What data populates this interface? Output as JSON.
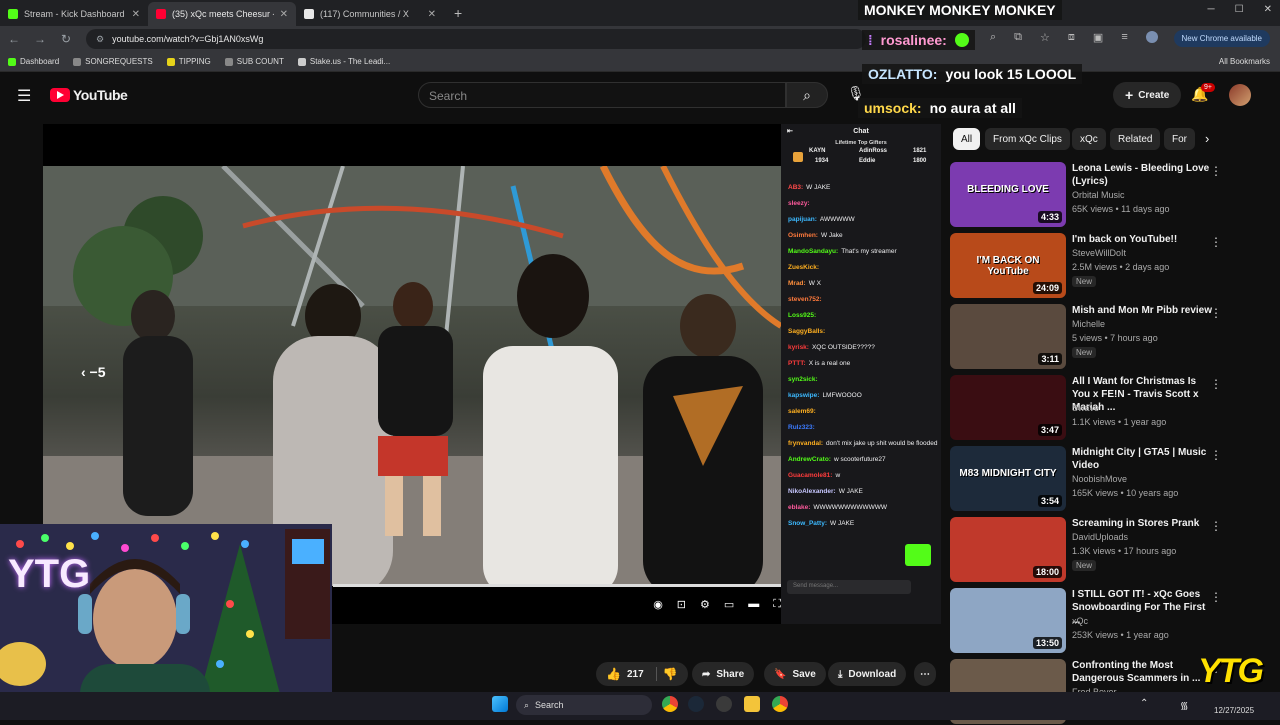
{
  "browser": {
    "tabs": [
      {
        "title": "Stream - Kick Dashboard",
        "favicon_color": "#53fc18"
      },
      {
        "title": "(35) xQc meets Cheesur - YouTube",
        "favicon_color": "#ff0033"
      },
      {
        "title": "(117) Communities / X",
        "favicon_color": "#e8e8e8"
      }
    ],
    "url": "youtube.com/watch?v=Gbj1AN0xsWg",
    "new_chrome_label": "New Chrome available",
    "bookmarks": [
      "Dashboard",
      "SONGREQUESTS",
      "TIPPING",
      "SUB COUNT",
      "Stake.us - The Leadi..."
    ],
    "all_bookmarks_label": "All Bookmarks"
  },
  "overlay_chat": [
    {
      "user": "",
      "message": "MONKEY MONKEY MONKEY"
    },
    {
      "user": "rosalinee:",
      "message": ""
    },
    {
      "user": "OZLATTO:",
      "message": "you look 15 LOOOL"
    },
    {
      "user": "umsock:",
      "message": "no aura at all"
    }
  ],
  "youtube": {
    "logo_text": "YouTube",
    "search_placeholder": "Search",
    "create_label": "Create",
    "notif_badge": "9+",
    "chips": [
      "All",
      "From xQc Clips",
      "xQc",
      "Related",
      "For"
    ],
    "actions": {
      "likes": "217",
      "share": "Share",
      "save": "Save",
      "download": "Download"
    }
  },
  "video": {
    "skip_label": "5",
    "chat_header": "Chat",
    "gifters_title": "Lifetime Top Gifters",
    "gifters": [
      {
        "name": "KAYN",
        "count": "1934"
      },
      {
        "name": "AdinRoss",
        "count": "1821"
      },
      {
        "name": "Eddie",
        "count": "1800"
      }
    ],
    "chat_lines": [
      {
        "user": "AB3:",
        "msg": "W JAKE",
        "color": "#ff4a4a"
      },
      {
        "user": "sleezy:",
        "msg": "",
        "color": "#ff5a9d"
      },
      {
        "user": "papijuan:",
        "msg": "AWWWWW",
        "color": "#3cb9ff"
      },
      {
        "user": "Osimhen:",
        "msg": "W Jake",
        "color": "#ff7a3c"
      },
      {
        "user": "MandoSandayu:",
        "msg": "That's my streamer",
        "color": "#53fc18"
      },
      {
        "user": "ZuesKick:",
        "msg": "",
        "color": "#ffb020"
      },
      {
        "user": "Mrad:",
        "msg": "W X",
        "color": "#ff8f3c"
      },
      {
        "user": "steven752:",
        "msg": "",
        "color": "#ff7a3c"
      },
      {
        "user": "Loss925:",
        "msg": "",
        "color": "#53fc18"
      },
      {
        "user": "SaggyBalls:",
        "msg": "",
        "color": "#ffb020"
      },
      {
        "user": "kyrisk:",
        "msg": "XQC OUTSIDE?????",
        "color": "#ff3c3c"
      },
      {
        "user": "PTTT:",
        "msg": "X is a real one",
        "color": "#ff3c3c"
      },
      {
        "user": "syn2sick:",
        "msg": "",
        "color": "#53fc18"
      },
      {
        "user": "kapswipe:",
        "msg": "LMFWOOOO",
        "color": "#3cb9ff"
      },
      {
        "user": "salem69:",
        "msg": "",
        "color": "#ffb020"
      },
      {
        "user": "Rulz323:",
        "msg": "",
        "color": "#3c7bff"
      },
      {
        "user": "frynvandal:",
        "msg": "don't mix jake up shit would be flooded",
        "color": "#ffb020"
      },
      {
        "user": "AndrewCrato:",
        "msg": "w scooterfuture27",
        "color": "#53fc18"
      },
      {
        "user": "Guacamole81:",
        "msg": "w",
        "color": "#ff3c3c"
      },
      {
        "user": "NikoAlexander:",
        "msg": "W JAKE",
        "color": "#c7c7ff"
      },
      {
        "user": "eblake:",
        "msg": "WWWWWWWWWWWW",
        "color": "#ff5a9d"
      },
      {
        "user": "Snow_Patty:",
        "msg": "W JAKE",
        "color": "#3cb9ff"
      }
    ],
    "send_placeholder": "Send message..."
  },
  "recommendations": [
    {
      "title": "Leona Lewis - Bleeding Love (Lyrics)",
      "channel": "Orbital Music",
      "meta": "65K views • 11 days ago",
      "duration": "4:33",
      "new": "",
      "thumb_text": "BLEEDING LOVE",
      "thumb_color": "#7c3bb0"
    },
    {
      "title": "I'm back on YouTube!!",
      "channel": "SteveWillDoIt",
      "meta": "2.5M views • 2 days ago",
      "duration": "24:09",
      "new": "New",
      "thumb_text": "I'M BACK ON YouTube",
      "thumb_color": "#b84a1a"
    },
    {
      "title": "Mish and Mon Mr Pibb review",
      "channel": "Michelle",
      "meta": "5 views • 7 hours ago",
      "duration": "3:11",
      "new": "New",
      "thumb_text": "",
      "thumb_color": "#5a4a3e"
    },
    {
      "title": "All I Want for Christmas Is You x FE!N - Travis Scott x Mariah ...",
      "channel": "Swave",
      "meta": "1.1K views • 1 year ago",
      "duration": "3:47",
      "new": "",
      "thumb_text": "",
      "thumb_color": "#3a0d12"
    },
    {
      "title": "Midnight City | GTA5 | Music Video",
      "channel": "NoobishMove",
      "meta": "165K views • 10 years ago",
      "duration": "3:54",
      "new": "",
      "thumb_text": "M83 MIDNIGHT CITY",
      "thumb_color": "#1d2a3a"
    },
    {
      "title": "Screaming in Stores Prank",
      "channel": "DavidUploads",
      "meta": "1.3K views • 17 hours ago",
      "duration": "18:00",
      "new": "New",
      "thumb_text": "",
      "thumb_color": "#c0392b"
    },
    {
      "title": "I STILL GOT IT! - xQc Goes Snowboarding For The First ...",
      "channel": "xQc",
      "meta": "253K views • 1 year ago",
      "duration": "13:50",
      "new": "",
      "thumb_text": "",
      "thumb_color": "#8ea6c4"
    },
    {
      "title": "Confronting the Most Dangerous Scammers in ...",
      "channel": "Fred Beyer",
      "meta": "",
      "duration": "",
      "new": "",
      "thumb_text": "",
      "thumb_color": "#6b5a4a"
    }
  ],
  "taskbar": {
    "search_label": "Search",
    "date": "12/27/2025"
  },
  "watermark": "YTG"
}
